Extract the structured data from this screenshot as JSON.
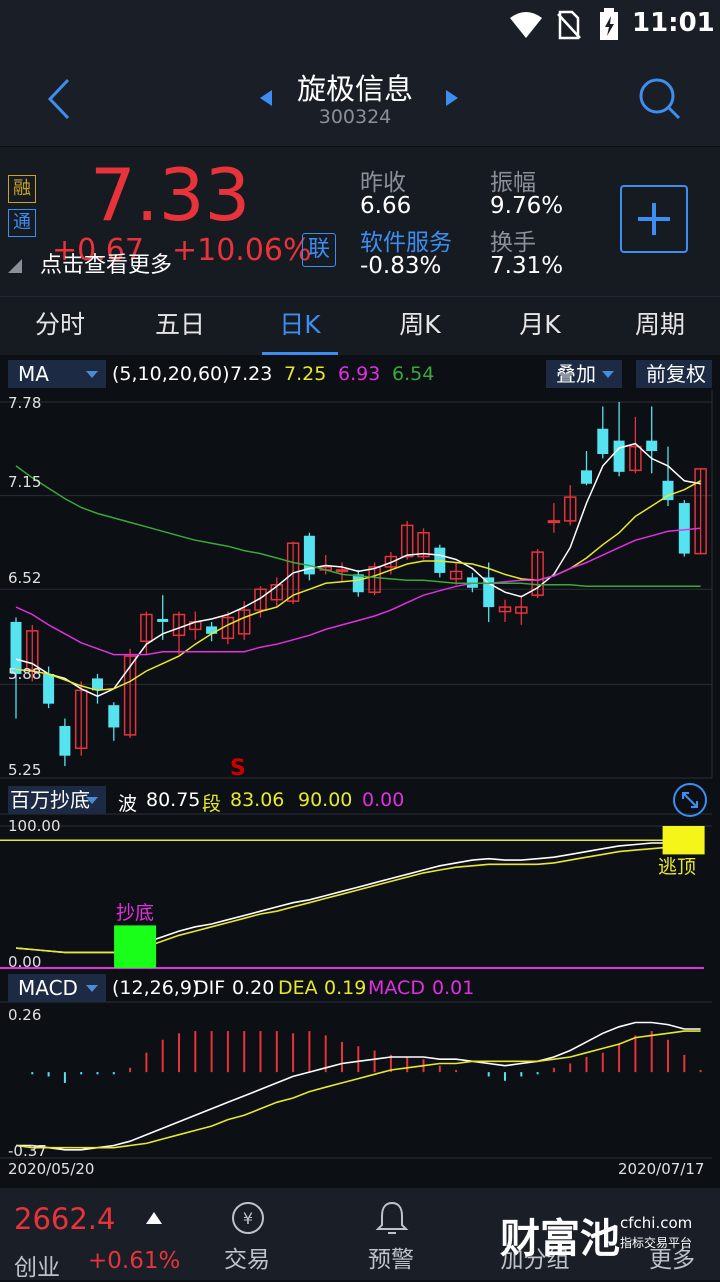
{
  "status_bar": {
    "time": "11:01"
  },
  "header": {
    "stock_name": "旋极信息",
    "stock_code": "300324"
  },
  "quote": {
    "badge_rong": "融",
    "badge_tong": "通",
    "price": "7.33",
    "change": "+0.67",
    "change_pct": "+10.06%",
    "lian_badge": "联",
    "hint": "点击查看更多",
    "prev_close_label": "昨收",
    "prev_close": "6.66",
    "amplitude_label": "振幅",
    "amplitude": "9.76%",
    "sector_label": "软件服务",
    "sector_change": "-0.83%",
    "turnover_label": "换手",
    "turnover": "7.31%"
  },
  "tabs": [
    {
      "label": "分时"
    },
    {
      "label": "五日"
    },
    {
      "label": "日K"
    },
    {
      "label": "周K"
    },
    {
      "label": "月K"
    },
    {
      "label": "周期"
    }
  ],
  "ma_bar": {
    "indicator": "MA",
    "params": "(5,10,20,60)",
    "v1": "7.23",
    "v2": "7.25",
    "v3": "6.93",
    "v4": "6.54",
    "overlay": "叠加",
    "adjust": "前复权"
  },
  "price_axis": [
    "7.78",
    "7.15",
    "6.52",
    "5.88",
    "5.25"
  ],
  "sell_marker": "S",
  "indicator_bar": {
    "name": "百万抄底",
    "bo_label": "波",
    "bo_value": "80.75",
    "duan_label": "段",
    "duan_value": "83.06",
    "v3": "90.00",
    "v4": "0.00"
  },
  "indicator_axis": {
    "top": "100.00",
    "bottom": "0.00"
  },
  "indicator_signals": {
    "buy": "抄底",
    "escape": "逃顶"
  },
  "macd_bar": {
    "name": "MACD",
    "params": "(12,26,9)",
    "dif_label": "DIF",
    "dif": "0.20",
    "dea_label": "DEA",
    "dea": "0.19",
    "macd_label": "MACD",
    "macd": "0.01"
  },
  "macd_axis": {
    "top": "0.26",
    "bottom": "-0.37"
  },
  "dates": {
    "start": "2020/05/20",
    "end": "2020/07/17"
  },
  "bottom_nav": {
    "index_value": "2662.4",
    "index_name": "创业",
    "index_change": "+0.61%",
    "trade": "交易",
    "alert": "预警",
    "add_group": "加分组",
    "more": "更多",
    "watermark": "财富池",
    "watermark_url": "cfchi.com",
    "watermark_sub": "指标交易平台"
  },
  "colors": {
    "up": "#e8333a",
    "down": "#55e3ef",
    "ma5": "#ffffff",
    "ma10": "#e8e82a",
    "ma20": "#e030e0",
    "ma60": "#3aa83a",
    "accent": "#3d8ef0"
  },
  "chart_data": [
    {
      "type": "candlestick",
      "title": "",
      "ylim": [
        5.25,
        7.78
      ],
      "yticks": [
        7.78,
        7.15,
        6.52,
        5.88,
        5.25
      ],
      "x_start": "2020/05/20",
      "x_end": "2020/07/17",
      "candles": [
        [
          6.3,
          5.95,
          6.33,
          5.65
        ],
        [
          5.98,
          6.24,
          6.28,
          5.9
        ],
        [
          5.95,
          5.75,
          6.0,
          5.72
        ],
        [
          5.6,
          5.4,
          5.65,
          5.33
        ],
        [
          5.45,
          5.84,
          5.9,
          5.4
        ],
        [
          5.92,
          5.84,
          5.95,
          5.75
        ],
        [
          5.74,
          5.59,
          5.76,
          5.5
        ],
        [
          5.54,
          6.07,
          6.12,
          5.52
        ],
        [
          6.17,
          6.35,
          6.37,
          6.08
        ],
        [
          6.32,
          6.3,
          6.48,
          6.18
        ],
        [
          6.21,
          6.35,
          6.37,
          6.08
        ],
        [
          6.25,
          6.3,
          6.37,
          6.18
        ],
        [
          6.27,
          6.22,
          6.3,
          6.17
        ],
        [
          6.19,
          6.33,
          6.37,
          6.15
        ],
        [
          6.22,
          6.38,
          6.44,
          6.18
        ],
        [
          6.38,
          6.52,
          6.54,
          6.33
        ],
        [
          6.45,
          6.55,
          6.6,
          6.4
        ],
        [
          6.44,
          6.83,
          6.84,
          6.42
        ],
        [
          6.88,
          6.62,
          6.9,
          6.58
        ],
        [
          6.65,
          6.67,
          6.75,
          6.62
        ],
        [
          6.64,
          6.65,
          6.7,
          6.57
        ],
        [
          6.62,
          6.5,
          6.65,
          6.47
        ],
        [
          6.5,
          6.67,
          6.7,
          6.48
        ],
        [
          6.67,
          6.74,
          6.77,
          6.62
        ],
        [
          6.74,
          6.95,
          6.98,
          6.72
        ],
        [
          6.74,
          6.9,
          6.93,
          6.72
        ],
        [
          6.8,
          6.63,
          6.82,
          6.6
        ],
        [
          6.59,
          6.64,
          6.7,
          6.55
        ],
        [
          6.6,
          6.53,
          6.63,
          6.5
        ],
        [
          6.6,
          6.4,
          6.7,
          6.3
        ],
        [
          6.37,
          6.4,
          6.45,
          6.3
        ],
        [
          6.36,
          6.4,
          6.48,
          6.28
        ],
        [
          6.48,
          6.77,
          6.79,
          6.46
        ],
        [
          6.98,
          6.98,
          7.1,
          6.9
        ],
        [
          6.98,
          7.14,
          7.22,
          6.95
        ],
        [
          7.32,
          7.23,
          7.45,
          7.22
        ],
        [
          7.6,
          7.43,
          7.75,
          7.4
        ],
        [
          7.52,
          7.31,
          7.78,
          7.28
        ],
        [
          7.32,
          7.48,
          7.68,
          7.3
        ],
        [
          7.52,
          7.45,
          7.75,
          7.3
        ],
        [
          7.25,
          7.12,
          7.48,
          7.08
        ],
        [
          7.1,
          6.76,
          7.12,
          6.74
        ],
        [
          6.76,
          7.33,
          7.33,
          6.76
        ]
      ],
      "ma_lines": {
        "MA5": [
          6.05,
          6.02,
          5.95,
          5.92,
          5.85,
          5.8,
          5.85,
          6.0,
          6.15,
          6.22,
          6.26,
          6.3,
          6.32,
          6.35,
          6.4,
          6.46,
          6.54,
          6.63,
          6.66,
          6.68,
          6.67,
          6.64,
          6.66,
          6.7,
          6.75,
          6.76,
          6.75,
          6.72,
          6.66,
          6.56,
          6.5,
          6.47,
          6.53,
          6.62,
          6.8,
          7.1,
          7.35,
          7.47,
          7.5,
          7.4,
          7.35,
          7.25,
          7.23
        ],
        "MA10": [
          5.98,
          5.97,
          5.95,
          5.91,
          5.87,
          5.84,
          5.85,
          5.9,
          5.97,
          6.02,
          6.07,
          6.15,
          6.22,
          6.28,
          6.33,
          6.37,
          6.4,
          6.48,
          6.52,
          6.56,
          6.57,
          6.58,
          6.61,
          6.65,
          6.69,
          6.71,
          6.71,
          6.7,
          6.69,
          6.66,
          6.62,
          6.59,
          6.58,
          6.61,
          6.66,
          6.73,
          6.82,
          6.9,
          7.01,
          7.08,
          7.15,
          7.19,
          7.25
        ],
        "MA20": [
          6.4,
          6.35,
          6.28,
          6.22,
          6.16,
          6.12,
          6.08,
          6.08,
          6.08,
          6.1,
          6.1,
          6.1,
          6.1,
          6.1,
          6.1,
          6.13,
          6.15,
          6.18,
          6.21,
          6.25,
          6.28,
          6.31,
          6.34,
          6.38,
          6.43,
          6.48,
          6.51,
          6.54,
          6.56,
          6.56,
          6.57,
          6.58,
          6.58,
          6.61,
          6.66,
          6.7,
          6.75,
          6.8,
          6.85,
          6.88,
          6.91,
          6.92,
          6.93
        ],
        "MA60": [
          7.35,
          7.27,
          7.2,
          7.13,
          7.07,
          7.03,
          7.0,
          6.97,
          6.94,
          6.91,
          6.88,
          6.85,
          6.83,
          6.81,
          6.78,
          6.76,
          6.73,
          6.7,
          6.68,
          6.65,
          6.62,
          6.61,
          6.6,
          6.59,
          6.58,
          6.58,
          6.57,
          6.56,
          6.56,
          6.56,
          6.56,
          6.56,
          6.55,
          6.55,
          6.55,
          6.54,
          6.54,
          6.54,
          6.54,
          6.54,
          6.54,
          6.54,
          6.54
        ]
      }
    },
    {
      "type": "line",
      "title": "百万抄底",
      "ylim": [
        0,
        100
      ],
      "series": [
        {
          "name": "波",
          "values": [
            14,
            13,
            12,
            11,
            11,
            11,
            11,
            14,
            18,
            22,
            26,
            29,
            31,
            34,
            37,
            40,
            43,
            46,
            48,
            51,
            54,
            57,
            60,
            63,
            66,
            69,
            72,
            74,
            76,
            77,
            76,
            76,
            77,
            78,
            80,
            82,
            84,
            86,
            87,
            88,
            88,
            88,
            88
          ]
        },
        {
          "name": "段",
          "values": [
            14,
            13,
            12,
            11,
            11,
            11,
            11,
            12,
            15,
            19,
            23,
            26,
            29,
            32,
            35,
            38,
            40,
            43,
            46,
            49,
            52,
            55,
            58,
            61,
            64,
            67,
            69,
            71,
            72,
            73,
            73,
            73,
            73,
            74,
            76,
            78,
            80,
            82,
            83,
            84,
            85,
            86,
            86
          ]
        }
      ],
      "reference_lines": [
        90,
        0
      ],
      "signals": [
        {
          "label": "抄底",
          "index": 7
        },
        {
          "label": "逃顶",
          "index": 42
        }
      ]
    },
    {
      "type": "bar",
      "title": "MACD",
      "ylim": [
        -0.37,
        0.26
      ],
      "series": [
        {
          "name": "MACD",
          "values": [
            0,
            -0.01,
            -0.02,
            -0.05,
            -0.01,
            -0.01,
            -0.01,
            0.02,
            0.09,
            0.15,
            0.18,
            0.19,
            0.19,
            0.19,
            0.19,
            0.19,
            0.19,
            0.18,
            0.19,
            0.17,
            0.14,
            0.12,
            0.1,
            0.08,
            0.07,
            0.06,
            0.03,
            0.01,
            0.0,
            -0.02,
            -0.04,
            -0.02,
            -0.01,
            0.02,
            0.04,
            0.07,
            0.09,
            0.13,
            0.17,
            0.19,
            0.15,
            0.08,
            0.01
          ]
        },
        {
          "name": "DIF",
          "values": [
            -0.34,
            -0.34,
            -0.35,
            -0.36,
            -0.36,
            -0.35,
            -0.34,
            -0.32,
            -0.29,
            -0.26,
            -0.23,
            -0.2,
            -0.17,
            -0.14,
            -0.11,
            -0.08,
            -0.05,
            -0.02,
            0.0,
            0.02,
            0.04,
            0.05,
            0.06,
            0.07,
            0.07,
            0.07,
            0.06,
            0.06,
            0.05,
            0.04,
            0.03,
            0.04,
            0.05,
            0.07,
            0.1,
            0.14,
            0.18,
            0.21,
            0.23,
            0.23,
            0.22,
            0.2,
            0.2
          ]
        },
        {
          "name": "DEA",
          "values": [
            -0.34,
            -0.35,
            -0.35,
            -0.35,
            -0.35,
            -0.35,
            -0.35,
            -0.34,
            -0.33,
            -0.31,
            -0.29,
            -0.27,
            -0.25,
            -0.22,
            -0.2,
            -0.17,
            -0.14,
            -0.12,
            -0.09,
            -0.07,
            -0.05,
            -0.03,
            -0.01,
            0.01,
            0.02,
            0.03,
            0.04,
            0.04,
            0.05,
            0.05,
            0.05,
            0.05,
            0.05,
            0.06,
            0.07,
            0.09,
            0.11,
            0.13,
            0.16,
            0.17,
            0.18,
            0.19,
            0.19
          ]
        }
      ]
    }
  ]
}
